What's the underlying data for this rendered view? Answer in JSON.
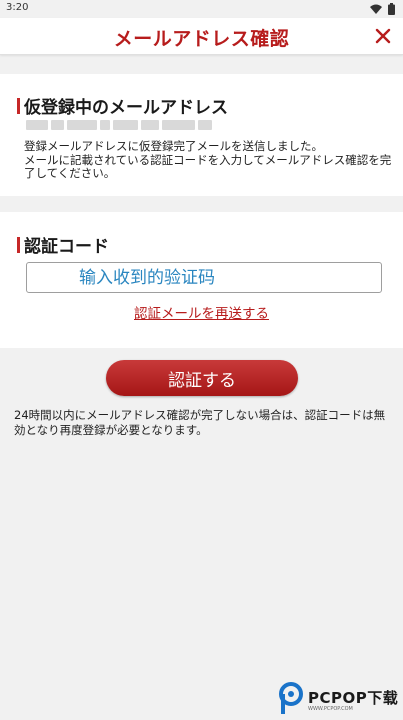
{
  "status_bar": {
    "time": "3:20"
  },
  "header": {
    "title": "メールアドレス確認"
  },
  "email_section": {
    "heading": "仮登録中のメールアドレス",
    "description_line1": "登録メールアドレスに仮登録完了メールを送信しました。",
    "description_line2": "メールに記載されている認証コードを入力してメールアドレス確認を完了してください。"
  },
  "code_section": {
    "heading": "認証コード",
    "input_placeholder": "输入收到的验证码",
    "resend_link": "認証メールを再送する"
  },
  "submit_button": {
    "label": "認証する"
  },
  "notice": "24時間以内にメールアドレス確認が完了しない場合は、認証コードは無効となり再度登録が必要となります。",
  "watermark": {
    "main": "PCPOP下载",
    "sub": "WWW.PCPOP.COM"
  },
  "colors": {
    "accent": "#b71c1c",
    "link_blue": "#1e7fb8",
    "background": "#f1f1f1"
  },
  "icons": {
    "close": "close-icon",
    "wifi": "wifi-icon",
    "battery": "battery-icon"
  }
}
